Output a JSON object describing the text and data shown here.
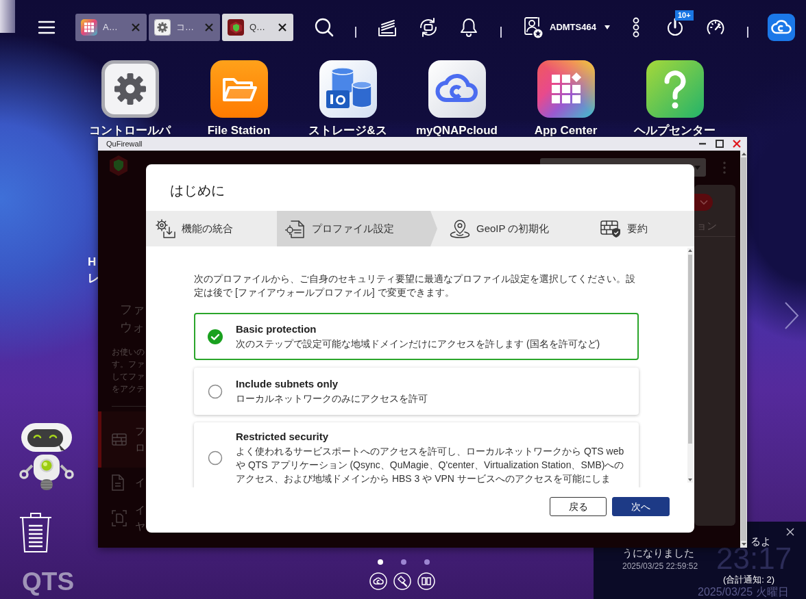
{
  "taskbar": {
    "tabs": [
      {
        "label": "A…",
        "selected": false
      },
      {
        "label": "コ…",
        "selected": false
      },
      {
        "label": "Q…",
        "selected": true
      }
    ],
    "user": "ADMTS464",
    "badge": "10+"
  },
  "desktop": {
    "shortcuts": [
      {
        "label": "コントロールパ"
      },
      {
        "label": "File Station"
      },
      {
        "label": "ストレージ&ス"
      },
      {
        "label": "myQNAPcloud"
      },
      {
        "label": "App Center"
      },
      {
        "label": "ヘルプセンター"
      }
    ],
    "widget_text_lines": [
      "H",
      "レ"
    ],
    "pages": [
      {
        "selected": true
      },
      {
        "selected": false
      },
      {
        "selected": false
      }
    ],
    "logo": "QTS"
  },
  "window": {
    "title": "QuFirewall",
    "heading_lines": [
      "ファ",
      "ウォ"
    ],
    "intro_lines": [
      "お使いの",
      "す。ファ",
      "してファ",
      "をアクテ"
    ],
    "menu": [
      {
        "lines": [
          "フ",
          "ロ"
        ],
        "selected": true
      },
      {
        "lines": [
          "イ"
        ],
        "selected": false
      },
      {
        "lines": [
          "イ",
          "ヤ"
        ],
        "selected": false
      }
    ],
    "side_tab": "ョン"
  },
  "dialog": {
    "title": "はじめに",
    "steps": [
      {
        "label": "機能の統合",
        "selected": false
      },
      {
        "label": "プロファイル設定",
        "selected": true
      },
      {
        "label": "GeoIP の初期化",
        "selected": false
      },
      {
        "label": "要約",
        "selected": false
      }
    ],
    "description": "次のプロファイルから、ご自身のセキュリティ要望に最適なプロファイル設定を選択してください。設定は後で [ファイアウォールプロファイル] で変更できます。",
    "profiles": [
      {
        "title": "Basic protection",
        "description": "次のステップで設定可能な地域ドメインだけにアクセスを許します (国名を許可など)",
        "selected": true
      },
      {
        "title": "Include subnets only",
        "description": "ローカルネットワークのみにアクセスを許可",
        "selected": false
      },
      {
        "title": "Restricted security",
        "description": "よく使われるサービスポートへのアクセスを許可し、ローカルネットワークから QTS web や QTS アプリケーション (Qsync、QuMagie、Q'center、Virtualization Station、SMB)へのアクセス、および地域ドメインから HBS 3 や VPN サービスへのアクセスを可能にしま",
        "selected": false
      }
    ],
    "buttons": [
      {
        "label": "戻る",
        "kind": "secondary"
      },
      {
        "label": "次へ",
        "kind": "primary"
      }
    ]
  },
  "notification": {
    "lines": [
      "るよ",
      "うになりました"
    ],
    "time": "2025/03/25 22:59:52",
    "total": "(合計通知: 2)"
  },
  "clock": {
    "time": "23:17",
    "date": "2025/03/25 火曜日"
  }
}
